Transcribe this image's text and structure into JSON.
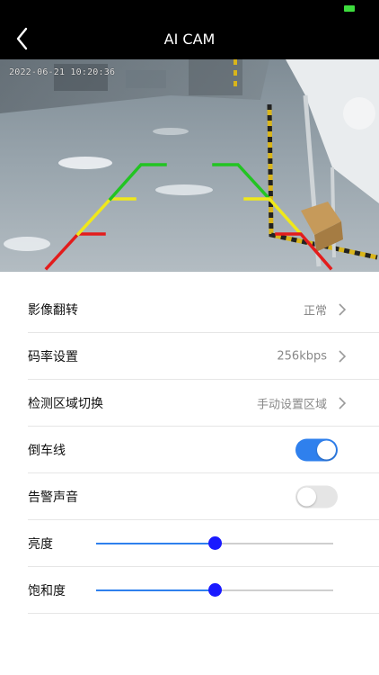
{
  "status_bar": {
    "battery_color": "#3ddc3d"
  },
  "header": {
    "title": "AI CAM",
    "back_icon": "chevron-left-icon"
  },
  "camera_view": {
    "timestamp": "2022-06-21 10:20:36",
    "guide_line_colors": [
      "#22c422",
      "#f0e81a",
      "#e31c1c"
    ]
  },
  "settings": {
    "rows": [
      {
        "label": "影像翻转",
        "value": "正常"
      },
      {
        "label": "码率设置",
        "value": "256kbps"
      },
      {
        "label": "检测区域切换",
        "value": "手动设置区域"
      }
    ],
    "toggles": [
      {
        "label": "倒车线",
        "on": true
      },
      {
        "label": "告警声音",
        "on": false
      }
    ],
    "sliders": [
      {
        "label": "亮度",
        "level": 0.5
      },
      {
        "label": "饱和度",
        "level": 0.5
      }
    ],
    "accent_color": "#2f80ed"
  }
}
